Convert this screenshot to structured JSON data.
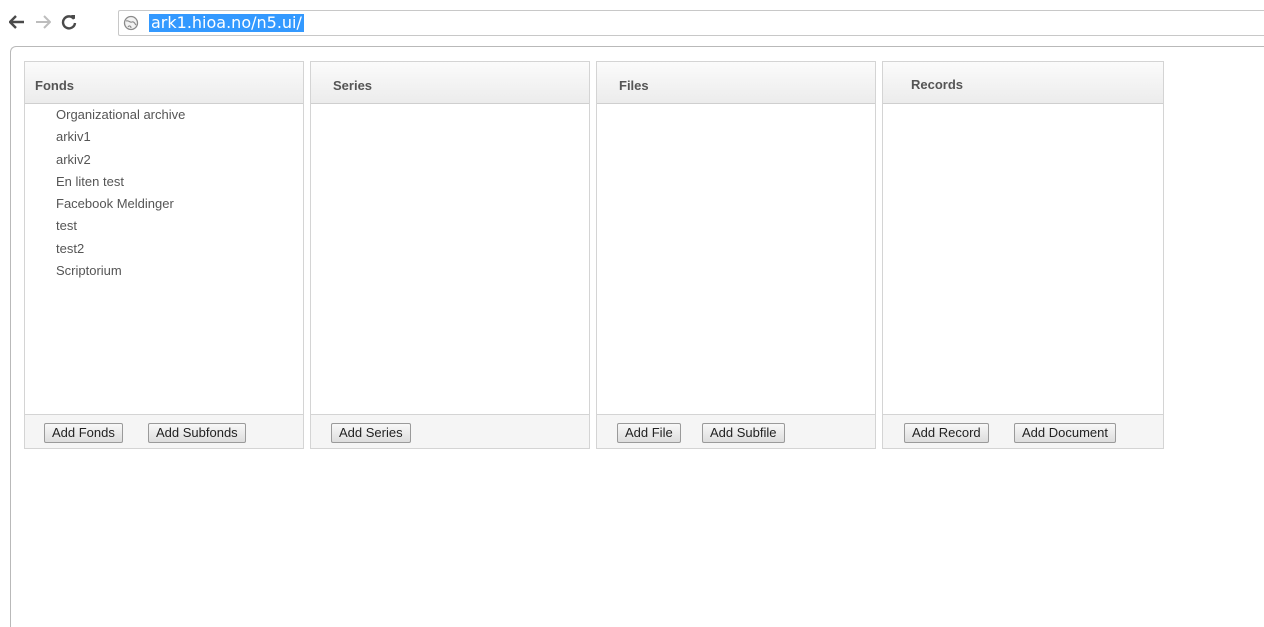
{
  "browser": {
    "url": "ark1.hioa.no/n5.ui/"
  },
  "panels": {
    "fonds": {
      "title": "Fonds",
      "items": [
        "Organizational archive",
        "arkiv1",
        "arkiv2",
        "En liten test",
        "Facebook Meldinger",
        "test",
        "test2",
        "Scriptorium"
      ],
      "buttons": [
        "Add Fonds",
        "Add Subfonds"
      ]
    },
    "series": {
      "title": "Series",
      "buttons": [
        "Add Series"
      ]
    },
    "files": {
      "title": "Files",
      "buttons": [
        "Add File",
        "Add Subfile"
      ]
    },
    "records": {
      "title": "Records",
      "buttons": [
        "Add Record",
        "Add Document"
      ]
    }
  }
}
